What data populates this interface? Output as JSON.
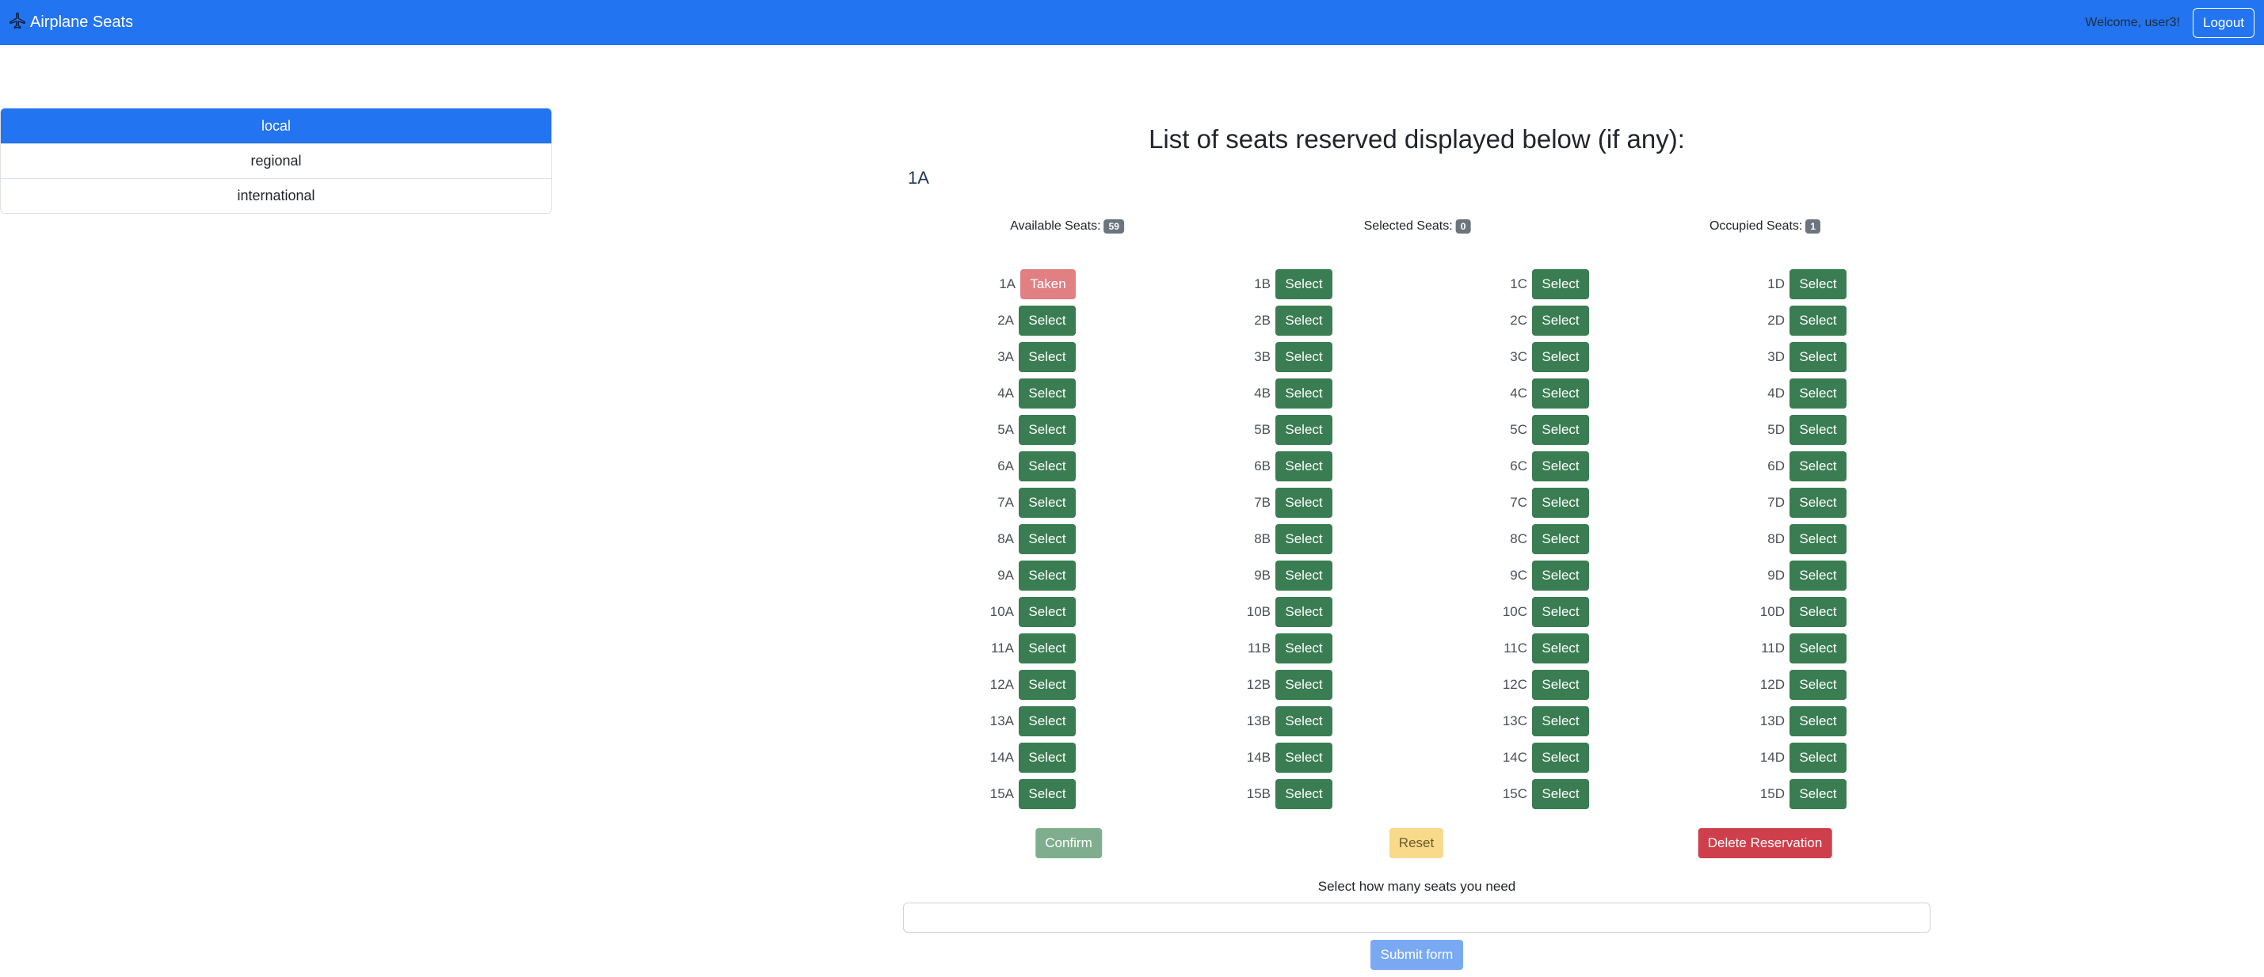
{
  "navbar": {
    "brand": "Airplane Seats",
    "brand_icon": "airplane-icon",
    "welcome": "Welcome, user3!",
    "logout_label": "Logout"
  },
  "sidebar": {
    "items": [
      {
        "label": "local",
        "active": true
      },
      {
        "label": "regional",
        "active": false
      },
      {
        "label": "international",
        "active": false
      }
    ]
  },
  "main": {
    "heading": "List of seats reserved displayed below (if any):",
    "reserved": "1A",
    "counts": {
      "available_label": "Available Seats:",
      "available_value": "59",
      "selected_label": "Selected Seats:",
      "selected_value": "0",
      "occupied_label": "Occupied Seats:",
      "occupied_value": "1"
    },
    "seat_columns": [
      {
        "letter": "A",
        "seats": [
          {
            "label": "1A",
            "button": "Taken",
            "status": "taken"
          },
          {
            "label": "2A",
            "button": "Select",
            "status": "available"
          },
          {
            "label": "3A",
            "button": "Select",
            "status": "available"
          },
          {
            "label": "4A",
            "button": "Select",
            "status": "available"
          },
          {
            "label": "5A",
            "button": "Select",
            "status": "available"
          },
          {
            "label": "6A",
            "button": "Select",
            "status": "available"
          },
          {
            "label": "7A",
            "button": "Select",
            "status": "available"
          },
          {
            "label": "8A",
            "button": "Select",
            "status": "available"
          },
          {
            "label": "9A",
            "button": "Select",
            "status": "available"
          },
          {
            "label": "10A",
            "button": "Select",
            "status": "available"
          },
          {
            "label": "11A",
            "button": "Select",
            "status": "available"
          },
          {
            "label": "12A",
            "button": "Select",
            "status": "available"
          },
          {
            "label": "13A",
            "button": "Select",
            "status": "available"
          },
          {
            "label": "14A",
            "button": "Select",
            "status": "available"
          },
          {
            "label": "15A",
            "button": "Select",
            "status": "available"
          }
        ]
      },
      {
        "letter": "B",
        "seats": [
          {
            "label": "1B",
            "button": "Select",
            "status": "available"
          },
          {
            "label": "2B",
            "button": "Select",
            "status": "available"
          },
          {
            "label": "3B",
            "button": "Select",
            "status": "available"
          },
          {
            "label": "4B",
            "button": "Select",
            "status": "available"
          },
          {
            "label": "5B",
            "button": "Select",
            "status": "available"
          },
          {
            "label": "6B",
            "button": "Select",
            "status": "available"
          },
          {
            "label": "7B",
            "button": "Select",
            "status": "available"
          },
          {
            "label": "8B",
            "button": "Select",
            "status": "available"
          },
          {
            "label": "9B",
            "button": "Select",
            "status": "available"
          },
          {
            "label": "10B",
            "button": "Select",
            "status": "available"
          },
          {
            "label": "11B",
            "button": "Select",
            "status": "available"
          },
          {
            "label": "12B",
            "button": "Select",
            "status": "available"
          },
          {
            "label": "13B",
            "button": "Select",
            "status": "available"
          },
          {
            "label": "14B",
            "button": "Select",
            "status": "available"
          },
          {
            "label": "15B",
            "button": "Select",
            "status": "available"
          }
        ]
      },
      {
        "letter": "C",
        "seats": [
          {
            "label": "1C",
            "button": "Select",
            "status": "available"
          },
          {
            "label": "2C",
            "button": "Select",
            "status": "available"
          },
          {
            "label": "3C",
            "button": "Select",
            "status": "available"
          },
          {
            "label": "4C",
            "button": "Select",
            "status": "available"
          },
          {
            "label": "5C",
            "button": "Select",
            "status": "available"
          },
          {
            "label": "6C",
            "button": "Select",
            "status": "available"
          },
          {
            "label": "7C",
            "button": "Select",
            "status": "available"
          },
          {
            "label": "8C",
            "button": "Select",
            "status": "available"
          },
          {
            "label": "9C",
            "button": "Select",
            "status": "available"
          },
          {
            "label": "10C",
            "button": "Select",
            "status": "available"
          },
          {
            "label": "11C",
            "button": "Select",
            "status": "available"
          },
          {
            "label": "12C",
            "button": "Select",
            "status": "available"
          },
          {
            "label": "13C",
            "button": "Select",
            "status": "available"
          },
          {
            "label": "14C",
            "button": "Select",
            "status": "available"
          },
          {
            "label": "15C",
            "button": "Select",
            "status": "available"
          }
        ]
      },
      {
        "letter": "D",
        "seats": [
          {
            "label": "1D",
            "button": "Select",
            "status": "available"
          },
          {
            "label": "2D",
            "button": "Select",
            "status": "available"
          },
          {
            "label": "3D",
            "button": "Select",
            "status": "available"
          },
          {
            "label": "4D",
            "button": "Select",
            "status": "available"
          },
          {
            "label": "5D",
            "button": "Select",
            "status": "available"
          },
          {
            "label": "6D",
            "button": "Select",
            "status": "available"
          },
          {
            "label": "7D",
            "button": "Select",
            "status": "available"
          },
          {
            "label": "8D",
            "button": "Select",
            "status": "available"
          },
          {
            "label": "9D",
            "button": "Select",
            "status": "available"
          },
          {
            "label": "10D",
            "button": "Select",
            "status": "available"
          },
          {
            "label": "11D",
            "button": "Select",
            "status": "available"
          },
          {
            "label": "12D",
            "button": "Select",
            "status": "available"
          },
          {
            "label": "13D",
            "button": "Select",
            "status": "available"
          },
          {
            "label": "14D",
            "button": "Select",
            "status": "available"
          },
          {
            "label": "15D",
            "button": "Select",
            "status": "available"
          }
        ]
      }
    ],
    "actions": {
      "confirm": "Confirm",
      "reset": "Reset",
      "delete": "Delete Reservation"
    },
    "form": {
      "label": "Select how many seats you need",
      "input_value": "",
      "submit": "Submit form"
    }
  },
  "colors": {
    "primary": "#2274f0",
    "select_green": "#3a7d52",
    "taken_red": "#e17f83",
    "confirm_green": "#7fae8e",
    "reset_yellow": "#f9d98a",
    "delete_red": "#cf3f4b",
    "submit_blue": "#7aa9f4"
  }
}
